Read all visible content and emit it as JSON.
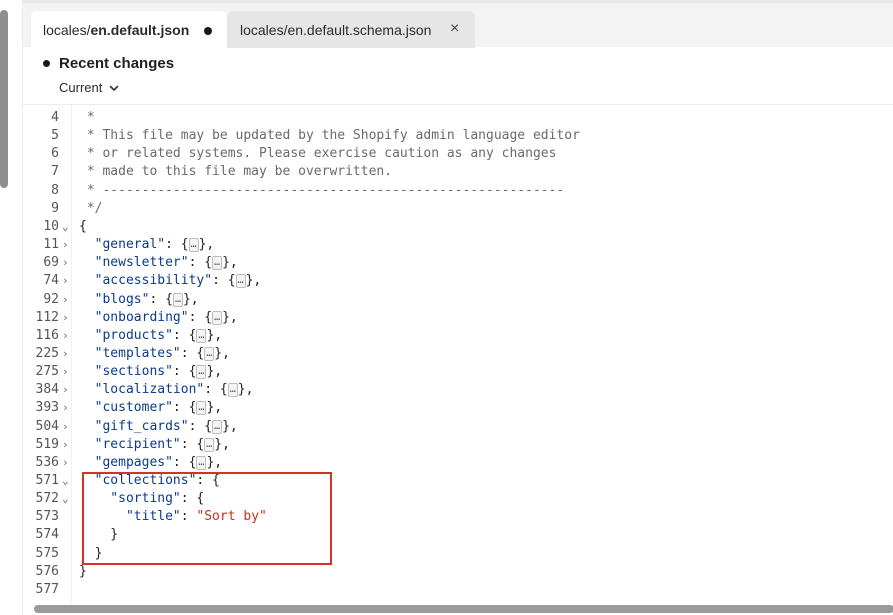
{
  "tabs": [
    {
      "dir": "locales/",
      "file": "en.default.json",
      "dirty": true,
      "active": true
    },
    {
      "dir": "locales/",
      "file": "en.default.schema.json",
      "close_symbol": "×",
      "active": false
    }
  ],
  "recent_changes": {
    "title": "Recent changes",
    "selected_version": "Current"
  },
  "code_lines": [
    {
      "num": "4",
      "fold": "",
      "segments": [
        {
          "cls": "tok-comment",
          "t": " *"
        }
      ]
    },
    {
      "num": "5",
      "fold": "",
      "segments": [
        {
          "cls": "tok-comment",
          "t": " * This file may be updated by the Shopify admin language editor"
        }
      ]
    },
    {
      "num": "6",
      "fold": "",
      "segments": [
        {
          "cls": "tok-comment",
          "t": " * or related systems. Please exercise caution as any changes"
        }
      ]
    },
    {
      "num": "7",
      "fold": "",
      "segments": [
        {
          "cls": "tok-comment",
          "t": " * made to this file may be overwritten."
        }
      ]
    },
    {
      "num": "8",
      "fold": "",
      "segments": [
        {
          "cls": "tok-comment",
          "t": " * -----------------------------------------------------------"
        }
      ]
    },
    {
      "num": "9",
      "fold": "",
      "segments": [
        {
          "cls": "tok-comment",
          "t": " */"
        }
      ]
    },
    {
      "num": "10",
      "fold": "⌄",
      "segments": [
        {
          "cls": "tok-punc",
          "t": "{"
        }
      ]
    },
    {
      "num": "11",
      "fold": "›",
      "segments": [
        {
          "cls": "tok-key",
          "t": "  \"general\""
        },
        {
          "cls": "tok-punc",
          "t": ": {"
        },
        {
          "cls": "fold-box",
          "t": "…"
        },
        {
          "cls": "tok-punc",
          "t": "},"
        }
      ]
    },
    {
      "num": "69",
      "fold": "›",
      "segments": [
        {
          "cls": "tok-key",
          "t": "  \"newsletter\""
        },
        {
          "cls": "tok-punc",
          "t": ": {"
        },
        {
          "cls": "fold-box",
          "t": "…"
        },
        {
          "cls": "tok-punc",
          "t": "},"
        }
      ]
    },
    {
      "num": "74",
      "fold": "›",
      "segments": [
        {
          "cls": "tok-key",
          "t": "  \"accessibility\""
        },
        {
          "cls": "tok-punc",
          "t": ": {"
        },
        {
          "cls": "fold-box",
          "t": "…"
        },
        {
          "cls": "tok-punc",
          "t": "},"
        }
      ]
    },
    {
      "num": "92",
      "fold": "›",
      "segments": [
        {
          "cls": "tok-key",
          "t": "  \"blogs\""
        },
        {
          "cls": "tok-punc",
          "t": ": {"
        },
        {
          "cls": "fold-box",
          "t": "…"
        },
        {
          "cls": "tok-punc",
          "t": "},"
        }
      ]
    },
    {
      "num": "112",
      "fold": "›",
      "segments": [
        {
          "cls": "tok-key",
          "t": "  \"onboarding\""
        },
        {
          "cls": "tok-punc",
          "t": ": {"
        },
        {
          "cls": "fold-box",
          "t": "…"
        },
        {
          "cls": "tok-punc",
          "t": "},"
        }
      ]
    },
    {
      "num": "116",
      "fold": "›",
      "segments": [
        {
          "cls": "tok-key",
          "t": "  \"products\""
        },
        {
          "cls": "tok-punc",
          "t": ": {"
        },
        {
          "cls": "fold-box",
          "t": "…"
        },
        {
          "cls": "tok-punc",
          "t": "},"
        }
      ]
    },
    {
      "num": "225",
      "fold": "›",
      "segments": [
        {
          "cls": "tok-key",
          "t": "  \"templates\""
        },
        {
          "cls": "tok-punc",
          "t": ": {"
        },
        {
          "cls": "fold-box",
          "t": "…"
        },
        {
          "cls": "tok-punc",
          "t": "},"
        }
      ]
    },
    {
      "num": "275",
      "fold": "›",
      "segments": [
        {
          "cls": "tok-key",
          "t": "  \"sections\""
        },
        {
          "cls": "tok-punc",
          "t": ": {"
        },
        {
          "cls": "fold-box",
          "t": "…"
        },
        {
          "cls": "tok-punc",
          "t": "},"
        }
      ]
    },
    {
      "num": "384",
      "fold": "›",
      "segments": [
        {
          "cls": "tok-key",
          "t": "  \"localization\""
        },
        {
          "cls": "tok-punc",
          "t": ": {"
        },
        {
          "cls": "fold-box",
          "t": "…"
        },
        {
          "cls": "tok-punc",
          "t": "},"
        }
      ]
    },
    {
      "num": "393",
      "fold": "›",
      "segments": [
        {
          "cls": "tok-key",
          "t": "  \"customer\""
        },
        {
          "cls": "tok-punc",
          "t": ": {"
        },
        {
          "cls": "fold-box",
          "t": "…"
        },
        {
          "cls": "tok-punc",
          "t": "},"
        }
      ]
    },
    {
      "num": "504",
      "fold": "›",
      "segments": [
        {
          "cls": "tok-key",
          "t": "  \"gift_cards\""
        },
        {
          "cls": "tok-punc",
          "t": ": {"
        },
        {
          "cls": "fold-box",
          "t": "…"
        },
        {
          "cls": "tok-punc",
          "t": "},"
        }
      ]
    },
    {
      "num": "519",
      "fold": "›",
      "segments": [
        {
          "cls": "tok-key",
          "t": "  \"recipient\""
        },
        {
          "cls": "tok-punc",
          "t": ": {"
        },
        {
          "cls": "fold-box",
          "t": "…"
        },
        {
          "cls": "tok-punc",
          "t": "},"
        }
      ]
    },
    {
      "num": "536",
      "fold": "›",
      "segments": [
        {
          "cls": "tok-key",
          "t": "  \"gempages\""
        },
        {
          "cls": "tok-punc",
          "t": ": {"
        },
        {
          "cls": "fold-box",
          "t": "…"
        },
        {
          "cls": "tok-punc",
          "t": "},"
        }
      ]
    },
    {
      "num": "571",
      "fold": "⌄",
      "segments": [
        {
          "cls": "tok-key",
          "t": "  \"collections\""
        },
        {
          "cls": "tok-punc",
          "t": ": {"
        }
      ]
    },
    {
      "num": "572",
      "fold": "⌄",
      "segments": [
        {
          "cls": "tok-key",
          "t": "    \"sorting\""
        },
        {
          "cls": "tok-punc",
          "t": ": {"
        }
      ]
    },
    {
      "num": "573",
      "fold": "",
      "segments": [
        {
          "cls": "tok-key",
          "t": "      \"title\""
        },
        {
          "cls": "tok-punc",
          "t": ": "
        },
        {
          "cls": "tok-str",
          "t": "\"Sort by\""
        }
      ]
    },
    {
      "num": "574",
      "fold": "",
      "segments": [
        {
          "cls": "tok-punc",
          "t": "    }"
        }
      ]
    },
    {
      "num": "575",
      "fold": "",
      "segments": [
        {
          "cls": "tok-punc",
          "t": "  }"
        }
      ]
    },
    {
      "num": "576",
      "fold": "",
      "segments": [
        {
          "cls": "tok-punc",
          "t": "}"
        }
      ]
    },
    {
      "num": "577",
      "fold": "",
      "segments": []
    }
  ],
  "colors": {
    "highlight_border": "#d93025",
    "string": "#c6301a",
    "key": "#0b3a8f"
  }
}
